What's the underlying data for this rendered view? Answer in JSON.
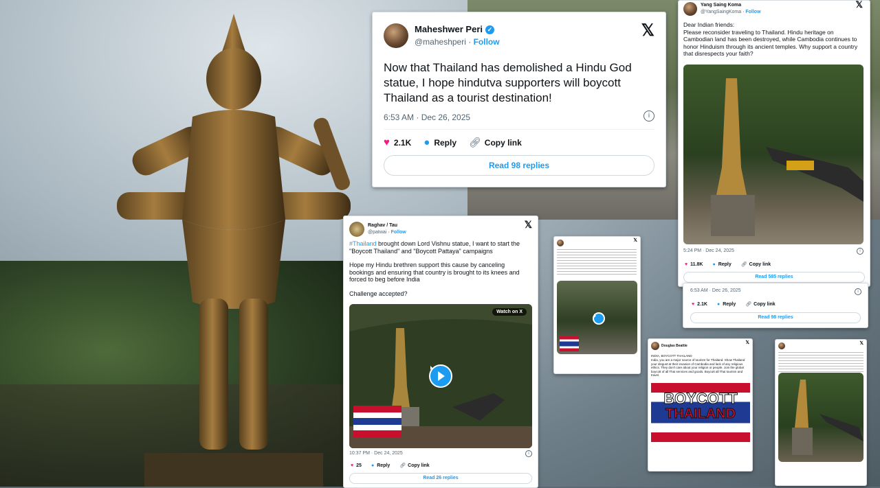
{
  "main_tweet": {
    "author": "Maheshwer Peri",
    "handle": "@maheshperi",
    "follow": "Follow",
    "text": "Now that Thailand has demolished a Hindu God statue, I hope hindutva supporters will boycott Thailand as a tourist destination!",
    "timestamp": "6:53 AM · Dec 26, 2025",
    "likes": "2.1K",
    "reply": "Reply",
    "copy_link": "Copy link",
    "read_replies": "Read 98 replies"
  },
  "raghav_tweet": {
    "author": "Raghav / Tau",
    "handle": "@patwai",
    "follow": "Follow",
    "hashtag": "#Thailand",
    "text_p1": " brought down Lord Vishnu statue, I want to start the \"Boycott Thailand\" and \"Boycott Pattaya\" campaigns",
    "text_p2": "Hope my Hindu brethren support this cause by canceling bookings and ensuring that country is brought to its knees and forced to beg before India",
    "text_p3": "Challenge accepted?",
    "watch": "Watch on X",
    "timestamp": "10:37 PM · Dec 24, 2025",
    "likes": "25",
    "reply": "Reply",
    "copy_link": "Copy link",
    "read_replies": "Read 26 replies"
  },
  "yang_tweet": {
    "author": "Yang Saing Koma",
    "handle": "@YangSaingKoma",
    "follow": "Follow",
    "text": "Dear Indian friends:\nPlease reconsider traveling to Thailand. Hindu heritage on Cambodian land has been destroyed, while Cambodia continues to honor Hinduism through its ancient temples. Why support a country that disrespects your faith?",
    "timestamp": "5:24 PM · Dec 24, 2025",
    "likes": "11.8K",
    "reply": "Reply",
    "copy_link": "Copy link",
    "read_replies": "Read 585 replies"
  },
  "peri_small": {
    "timestamp": "6:53 AM · Dec 26, 2025",
    "likes": "2.1K",
    "reply": "Reply",
    "copy_link": "Copy link",
    "read_replies": "Read 98 replies"
  },
  "douglas_tweet": {
    "author": "Douglas Beattie",
    "text_title": "INDIA, BOYCOTT THAILAND",
    "text": "India, you are a major source of tourism for Thailand. Show Thailand your disgust at their invasion of Cambodia and lack of any religious ethics. They don't care about your religion or people. Join the global boycott of all Thai services and goods. Boycott all Thai tourism and travel.",
    "banner_line1": "BOYCOTT",
    "banner_line2": "THAILAND"
  },
  "colors": {
    "accent": "#1d9bf0",
    "heart": "#f91880",
    "text": "#0f1419",
    "muted": "#536471"
  }
}
